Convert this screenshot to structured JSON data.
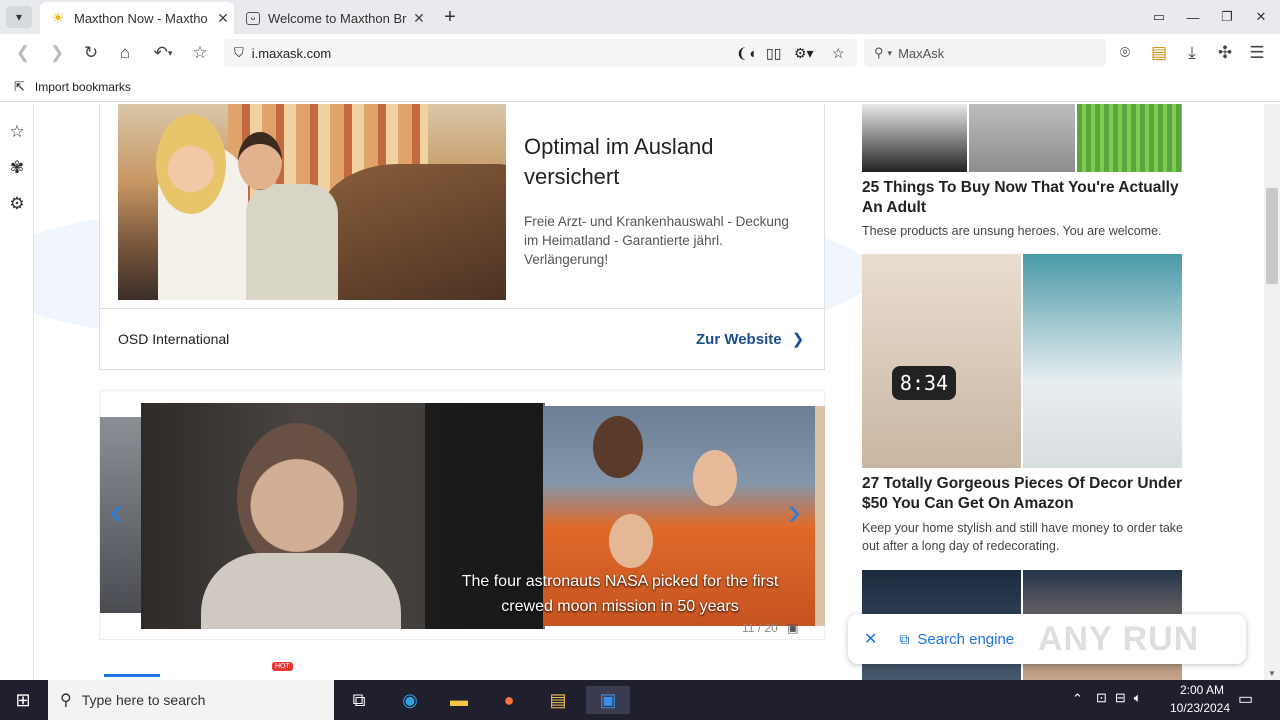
{
  "tabs": [
    {
      "title": "Maxthon Now - Maxtho",
      "active": true
    },
    {
      "title": "Welcome to Maxthon Br",
      "active": false
    }
  ],
  "address": {
    "url": "i.maxask.com"
  },
  "search": {
    "placeholder": "MaxAsk"
  },
  "bookmarks_bar": {
    "import_label": "Import bookmarks"
  },
  "ad": {
    "headline": "Optimal im Ausland versichert",
    "description": "Freie Arzt- und Krankenhauswahl - Deckung im Heimatland - Garantierte jährl. Verlängerung!",
    "advertiser": "OSD International",
    "cta": "Zur Website"
  },
  "slideshow": {
    "caption": "The four astronauts NASA picked for the first crewed moon mission in 50 years",
    "counter": "11 / 20"
  },
  "tabs_strip": {
    "hot_badge": "HOT"
  },
  "right_articles": [
    {
      "title": "25 Things To Buy Now That You're Actually An Adult",
      "desc": "These products are unsung heroes. You are welcome."
    },
    {
      "title": "27 Totally Gorgeous Pieces Of Decor Under $50 You Can Get On Amazon",
      "desc": "Keep your home stylish and still have money to order take out after a long day of redecorating."
    }
  ],
  "clock_display": "8:34",
  "popup": {
    "label": "Search engine"
  },
  "watermark": "ANY RUN",
  "taskbar": {
    "search_placeholder": "Type here to search",
    "time": "2:00 AM",
    "date": "10/23/2024"
  },
  "colors": {
    "accent": "#1a73e8",
    "link": "#1a4f8a",
    "taskbar": "#1f1f2e"
  }
}
